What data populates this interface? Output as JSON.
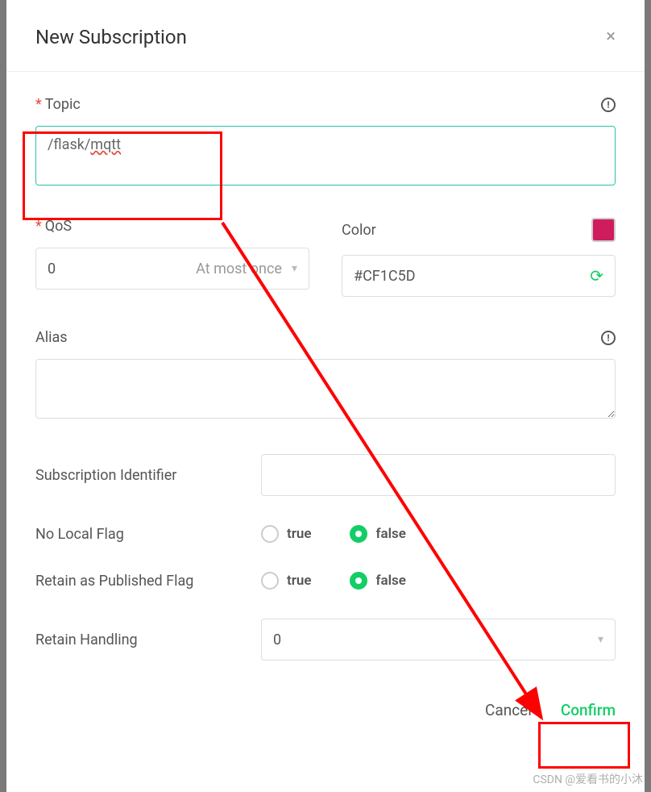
{
  "dialog": {
    "title": "New Subscription",
    "close_icon": "×"
  },
  "form": {
    "topic": {
      "label": "Topic",
      "value_prefix": "/flask/",
      "value_spell": "mqtt"
    },
    "qos": {
      "label": "QoS",
      "value": "0",
      "hint": "At most once"
    },
    "color": {
      "label": "Color",
      "value": "#CF1C5D"
    },
    "alias": {
      "label": "Alias",
      "value": ""
    },
    "sub_id": {
      "label": "Subscription Identifier",
      "value": ""
    },
    "no_local": {
      "label": "No Local Flag",
      "opt_true": "true",
      "opt_false": "false",
      "selected": "false"
    },
    "retain_pub": {
      "label": "Retain as Published Flag",
      "opt_true": "true",
      "opt_false": "false",
      "selected": "false"
    },
    "retain_handling": {
      "label": "Retain Handling",
      "value": "0"
    }
  },
  "footer": {
    "cancel": "Cancel",
    "confirm": "Confirm"
  },
  "watermark": "CSDN @爱看书的小沐"
}
